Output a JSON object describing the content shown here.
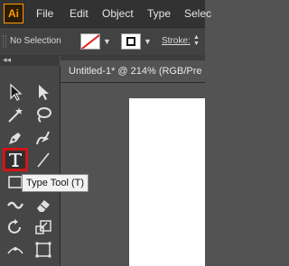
{
  "app": {
    "logo_text": "Ai",
    "brand_color": "#ff9a00"
  },
  "menu": [
    "File",
    "Edit",
    "Object",
    "Type",
    "Selec"
  ],
  "control_bar": {
    "selection_label": "No Selection",
    "stroke_label": "Stroke:",
    "fill_swatch": "none-swatch",
    "stroke_swatch": "stroke-swatch"
  },
  "panel": {
    "collapse_label": "◂◂"
  },
  "document": {
    "tab_title": "Untitled-1* @ 214% (RGB/Pre"
  },
  "tools": [
    "selection-tool",
    "direct-selection-tool",
    "magic-wand-tool",
    "lasso-tool",
    "pen-tool",
    "curvature-tool",
    "type-tool",
    "line-segment-tool",
    "rectangle-tool",
    "paintbrush-tool",
    "shaper-tool",
    "eraser-tool",
    "rotate-tool",
    "scale-tool",
    "width-tool",
    "free-transform-tool"
  ],
  "tooltip": {
    "text": "Type Tool (T)"
  },
  "colors": {
    "highlight": "#d01515",
    "menubar": "#323232",
    "toolbar": "#464646"
  }
}
